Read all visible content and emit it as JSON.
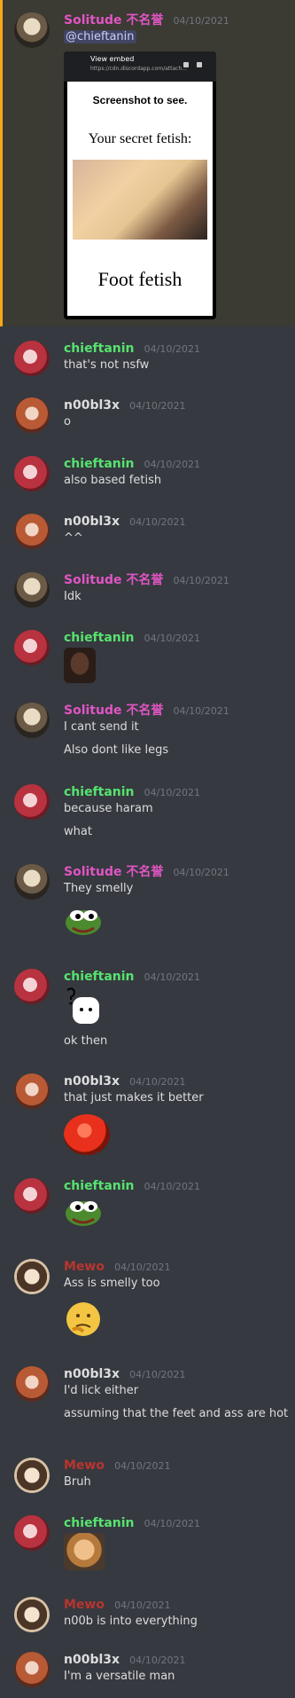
{
  "users": {
    "solitude": {
      "name": "Solitude 不名誉",
      "color": "#e055c4"
    },
    "chieftanin": {
      "name": "chieftanin",
      "color": "#57e36f"
    },
    "noobl3x": {
      "name": "n00bl3x",
      "color": "#dcddde"
    },
    "mewo": {
      "name": "Mewo",
      "color": "#b9352f"
    }
  },
  "messages": [
    {
      "user": "Solitude 不名誉",
      "time": "04/10/2021",
      "lines": [
        "@chieftanin"
      ],
      "attachment": {
        "app_title": "View embed",
        "app_url": "https://cdn.discordapp.com/attach...",
        "top_text": "Screenshot to see.",
        "mid_text": "Your secret fetish:",
        "bottom_text": "Foot fetish"
      }
    },
    {
      "user": "chieftanin",
      "time": "04/10/2021",
      "lines": [
        "that's not nsfw"
      ]
    },
    {
      "user": "n00bl3x",
      "time": "04/10/2021",
      "lines": [
        "o"
      ]
    },
    {
      "user": "chieftanin",
      "time": "04/10/2021",
      "lines": [
        "also based fetish"
      ]
    },
    {
      "user": "n00bl3x",
      "time": "04/10/2021",
      "lines": [
        "^^"
      ]
    },
    {
      "user": "Solitude 不名誉",
      "time": "04/10/2021",
      "lines": [
        "Idk"
      ]
    },
    {
      "user": "chieftanin",
      "time": "04/10/2021",
      "lines": []
    },
    {
      "user": "Solitude 不名誉",
      "time": "04/10/2021",
      "lines": [
        "I cant send it",
        "Also dont like legs"
      ]
    },
    {
      "user": "chieftanin",
      "time": "04/10/2021",
      "lines": [
        "because haram",
        "what"
      ]
    },
    {
      "user": "Solitude 不名誉",
      "time": "04/10/2021",
      "lines": [
        "They smelly"
      ]
    },
    {
      "user": "chieftanin",
      "time": "04/10/2021",
      "lines": [
        "ok then"
      ]
    },
    {
      "user": "n00bl3x",
      "time": "04/10/2021",
      "lines": [
        "that just makes it better"
      ]
    },
    {
      "user": "chieftanin",
      "time": "04/10/2021",
      "lines": []
    },
    {
      "user": "Mewo",
      "time": "04/10/2021",
      "lines": [
        "Ass is smelly too"
      ]
    },
    {
      "user": "n00bl3x",
      "time": "04/10/2021",
      "lines": [
        "I'd lick either",
        "assuming that the feet and ass are hot"
      ]
    },
    {
      "user": "Mewo",
      "time": "04/10/2021",
      "lines": [
        "Bruh"
      ]
    },
    {
      "user": "chieftanin",
      "time": "04/10/2021",
      "lines": []
    },
    {
      "user": "Mewo",
      "time": "04/10/2021",
      "lines": [
        "n00b is into everything"
      ]
    },
    {
      "user": "n00bl3x",
      "time": "04/10/2021",
      "lines": [
        "I'm a versatile man"
      ]
    }
  ],
  "icons": [
    "pepe-emoji",
    "thinking-emoji",
    "question-sticker",
    "tomato-emoji",
    "avatar"
  ]
}
